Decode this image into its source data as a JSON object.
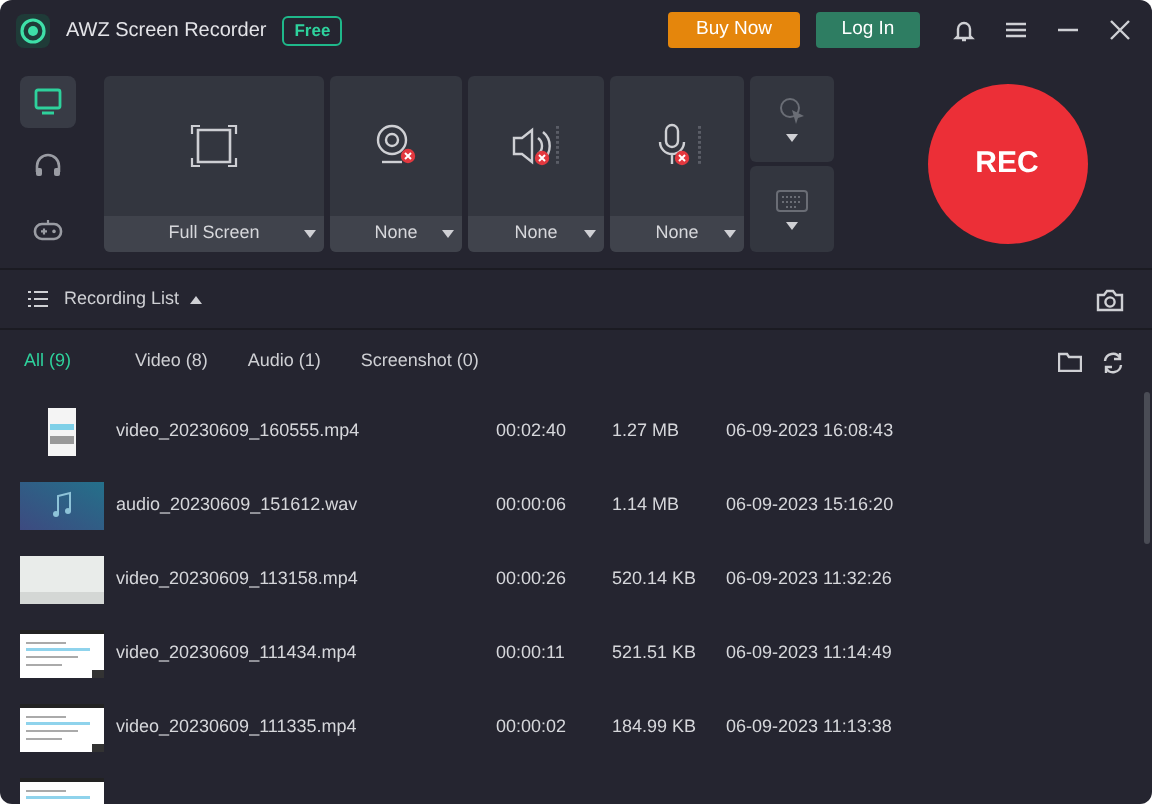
{
  "window": {
    "title": "AWZ Screen Recorder",
    "badge": "Free"
  },
  "header_buttons": [
    {
      "label": "Buy Now",
      "kind": "buy"
    },
    {
      "label": "Log In",
      "kind": "login"
    }
  ],
  "modes": [
    {
      "kind": "screen",
      "selected": true
    },
    {
      "kind": "audio",
      "selected": false
    },
    {
      "kind": "game",
      "selected": false
    }
  ],
  "sources": [
    {
      "kind": "screen",
      "value": "Full Screen",
      "off": false
    },
    {
      "kind": "webcam",
      "value": "None",
      "off": true
    },
    {
      "kind": "speaker",
      "value": "None",
      "off": true
    },
    {
      "kind": "mic",
      "value": "None",
      "off": true
    }
  ],
  "record_button": {
    "label": "REC"
  },
  "recording_list": {
    "title": "Recording List",
    "tabs": [
      {
        "label": "All (9)",
        "selected": true
      },
      {
        "label": "Video (8)",
        "selected": false
      },
      {
        "label": "Audio (1)",
        "selected": false
      },
      {
        "label": "Screenshot (0)",
        "selected": false
      }
    ],
    "rows": [
      {
        "kind": "phone",
        "name": "video_20230609_160555.mp4",
        "duration": "00:02:40",
        "size": "1.27 MB",
        "date": "06-09-2023 16:08:43"
      },
      {
        "kind": "audio",
        "name": "audio_20230609_151612.wav",
        "duration": "00:00:06",
        "size": "1.14 MB",
        "date": "06-09-2023 15:16:20"
      },
      {
        "kind": "blank",
        "name": "video_20230609_113158.mp4",
        "duration": "00:00:26",
        "size": "520.14 KB",
        "date": "06-09-2023 11:32:26"
      },
      {
        "kind": "page",
        "name": "video_20230609_111434.mp4",
        "duration": "00:00:11",
        "size": "521.51 KB",
        "date": "06-09-2023 11:14:49"
      },
      {
        "kind": "page",
        "name": "video_20230609_111335.mp4",
        "duration": "00:00:02",
        "size": "184.99 KB",
        "date": "06-09-2023 11:13:38"
      },
      {
        "kind": "page"
      }
    ]
  }
}
